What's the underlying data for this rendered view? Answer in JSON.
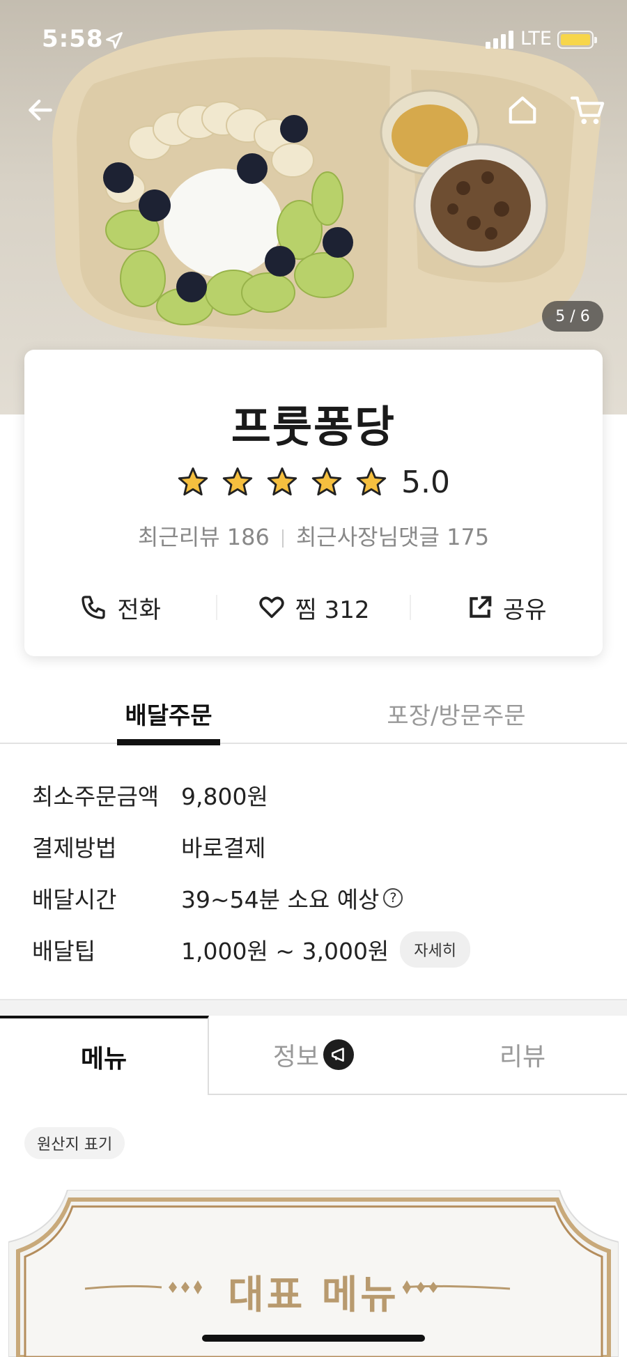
{
  "status_bar": {
    "time": "5:58",
    "network": "LTE"
  },
  "hero": {
    "image_counter": "5 / 6"
  },
  "store": {
    "name": "프룻퐁당",
    "rating": "5.0",
    "stars": 5,
    "recent_reviews": "최근리뷰 186",
    "owner_replies": "최근사장님댓글 175",
    "actions": {
      "call": "전화",
      "favorite": "찜 312",
      "share": "공유"
    }
  },
  "order_tabs": {
    "delivery": "배달주문",
    "pickup": "포장/방문주문"
  },
  "info": {
    "min_order_label": "최소주문금액",
    "min_order_value": "9,800원",
    "payment_label": "결제방법",
    "payment_value": "바로결제",
    "time_label": "배달시간",
    "time_value": "39~54분 소요 예상",
    "tip_label": "배달팁",
    "tip_value": "1,000원 ~ 3,000원",
    "tip_detail": "자세히"
  },
  "menu_tabs": {
    "menu": "메뉴",
    "info": "정보",
    "review": "리뷰"
  },
  "origin_chip": "원산지 표기",
  "banner_title": "대표 메뉴",
  "colors": {
    "star": "#f5bf3f",
    "accent_gold": "#b89a6e",
    "active_tab": "#111111"
  }
}
